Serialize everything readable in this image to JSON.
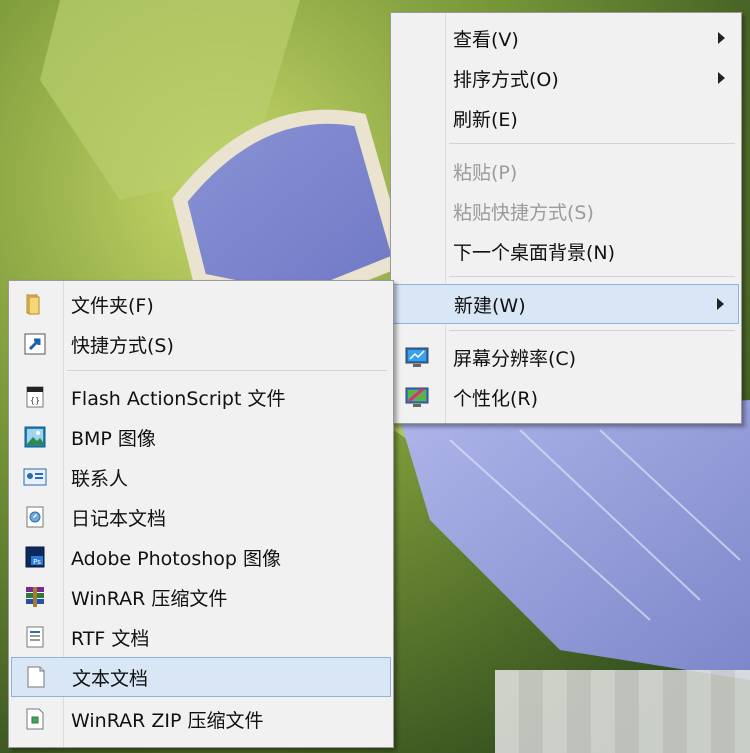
{
  "desktop_menu": {
    "items": [
      {
        "label": "查看(V)",
        "has_submenu": true
      },
      {
        "label": "排序方式(O)",
        "has_submenu": true
      },
      {
        "label": "刷新(E)"
      },
      {
        "label": "粘贴(P)",
        "disabled": true
      },
      {
        "label": "粘贴快捷方式(S)",
        "disabled": true
      },
      {
        "label": "下一个桌面背景(N)"
      },
      {
        "label": "新建(W)",
        "has_submenu": true,
        "highlighted": true
      },
      {
        "label": "屏幕分辨率(C)",
        "icon": "screen-resolution-icon"
      },
      {
        "label": "个性化(R)",
        "icon": "personalize-icon"
      }
    ]
  },
  "new_submenu": {
    "items": [
      {
        "label": "文件夹(F)",
        "icon": "folder-icon"
      },
      {
        "label": "快捷方式(S)",
        "icon": "shortcut-icon"
      },
      {
        "label": "Flash ActionScript 文件",
        "icon": "actionscript-file-icon"
      },
      {
        "label": "BMP 图像",
        "icon": "bmp-image-icon"
      },
      {
        "label": "联系人",
        "icon": "contact-icon"
      },
      {
        "label": "日记本文档",
        "icon": "journal-document-icon"
      },
      {
        "label": "Adobe Photoshop 图像",
        "icon": "photoshop-icon"
      },
      {
        "label": "WinRAR 压缩文件",
        "icon": "winrar-icon"
      },
      {
        "label": "RTF 文档",
        "icon": "rtf-document-icon"
      },
      {
        "label": "文本文档",
        "icon": "text-document-icon",
        "highlighted": true
      },
      {
        "label": "WinRAR ZIP 压缩文件",
        "icon": "winrar-zip-icon"
      }
    ]
  },
  "colors": {
    "menu_bg": "#f1f1f1",
    "highlight_bg": "#d8e6f6",
    "highlight_border": "#8fb2dd",
    "disabled_text": "#9b9b9b"
  }
}
